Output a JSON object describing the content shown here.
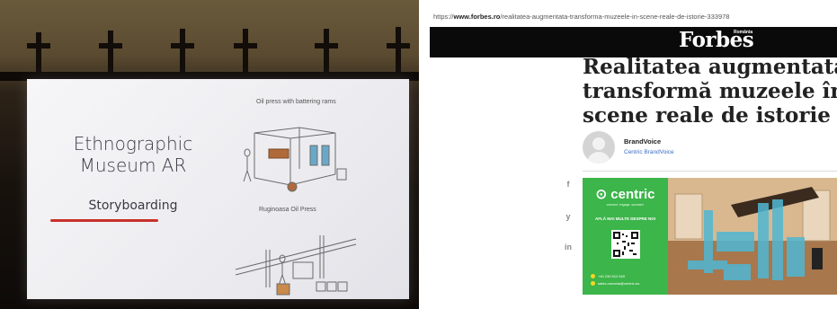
{
  "slide_photo": {
    "title_line1": "Ethnographic",
    "title_line2": "Museum AR",
    "subtitle": "Storyboarding",
    "caption_top": "Oil press with battering rams",
    "caption_bottom": "Ruginoasa Oil Press"
  },
  "article": {
    "url_prefix": "https://",
    "url_domain": "www.forbes.ro",
    "url_path": "/realitatea-augmentata-transforma-muzeele-in-scene-reale-de-istorie-333978",
    "logo": "Forbes",
    "logo_edition": "România",
    "headline": [
      "Realitatea augmentata",
      "transformă muzeele în",
      "scene reale de istorie"
    ],
    "author": "BrandVoice",
    "author_sub": "Centric BrandVoice",
    "share_icons": [
      "facebook-icon",
      "twitter-icon",
      "linkedin-icon"
    ],
    "share_labels": [
      "f",
      "y",
      "in"
    ],
    "ad": {
      "brand": "centric",
      "tagline": "connect. engage. succeed.",
      "cta": "AFLĂ MAI MULTE DESPRE NOI",
      "phone": "+40 230 512 620",
      "email": "sales.romania@centric.eu",
      "accent_color": "#3cb54a"
    }
  }
}
